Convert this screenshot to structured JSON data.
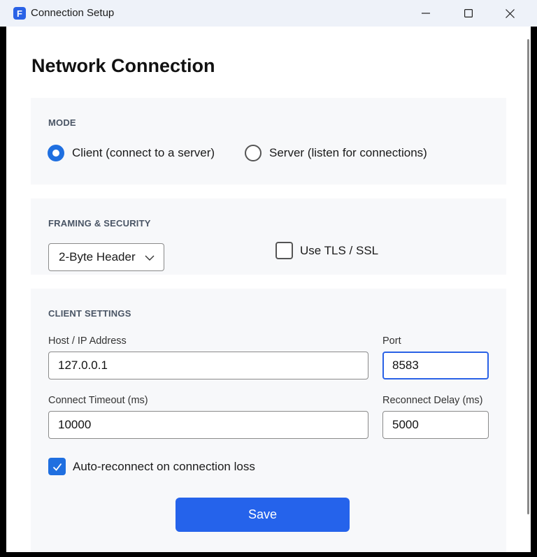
{
  "window": {
    "app_icon_letter": "F",
    "title": "Connection Setup"
  },
  "page": {
    "heading": "Network Connection"
  },
  "mode": {
    "label": "MODE",
    "options": [
      {
        "label": "Client (connect to a server)",
        "selected": true
      },
      {
        "label": "Server (listen for connections)",
        "selected": false
      }
    ]
  },
  "framing": {
    "label": "FRAMING & SECURITY",
    "framing_select_value": "2-Byte Header",
    "tls_label": "Use TLS / SSL",
    "tls_checked": false
  },
  "client_settings": {
    "label": "CLIENT SETTINGS",
    "host_label": "Host / IP Address",
    "host_value": "127.0.0.1",
    "port_label": "Port",
    "port_value": "8583",
    "timeout_label": "Connect Timeout (ms)",
    "timeout_value": "10000",
    "reconnect_delay_label": "Reconnect Delay (ms)",
    "reconnect_delay_value": "5000",
    "auto_reconnect_label": "Auto-reconnect on connection loss",
    "auto_reconnect_checked": true
  },
  "actions": {
    "save_label": "Save"
  },
  "colors": {
    "accent": "#2563eb",
    "titlebar": "#eef2f9",
    "section_bg": "#f7f8fa"
  },
  "icons": {
    "app": "app-logo-icon",
    "minimize": "minimize-icon",
    "maximize": "maximize-icon",
    "close": "close-icon",
    "dropdown": "chevron-down-icon",
    "check": "checkmark-icon"
  }
}
